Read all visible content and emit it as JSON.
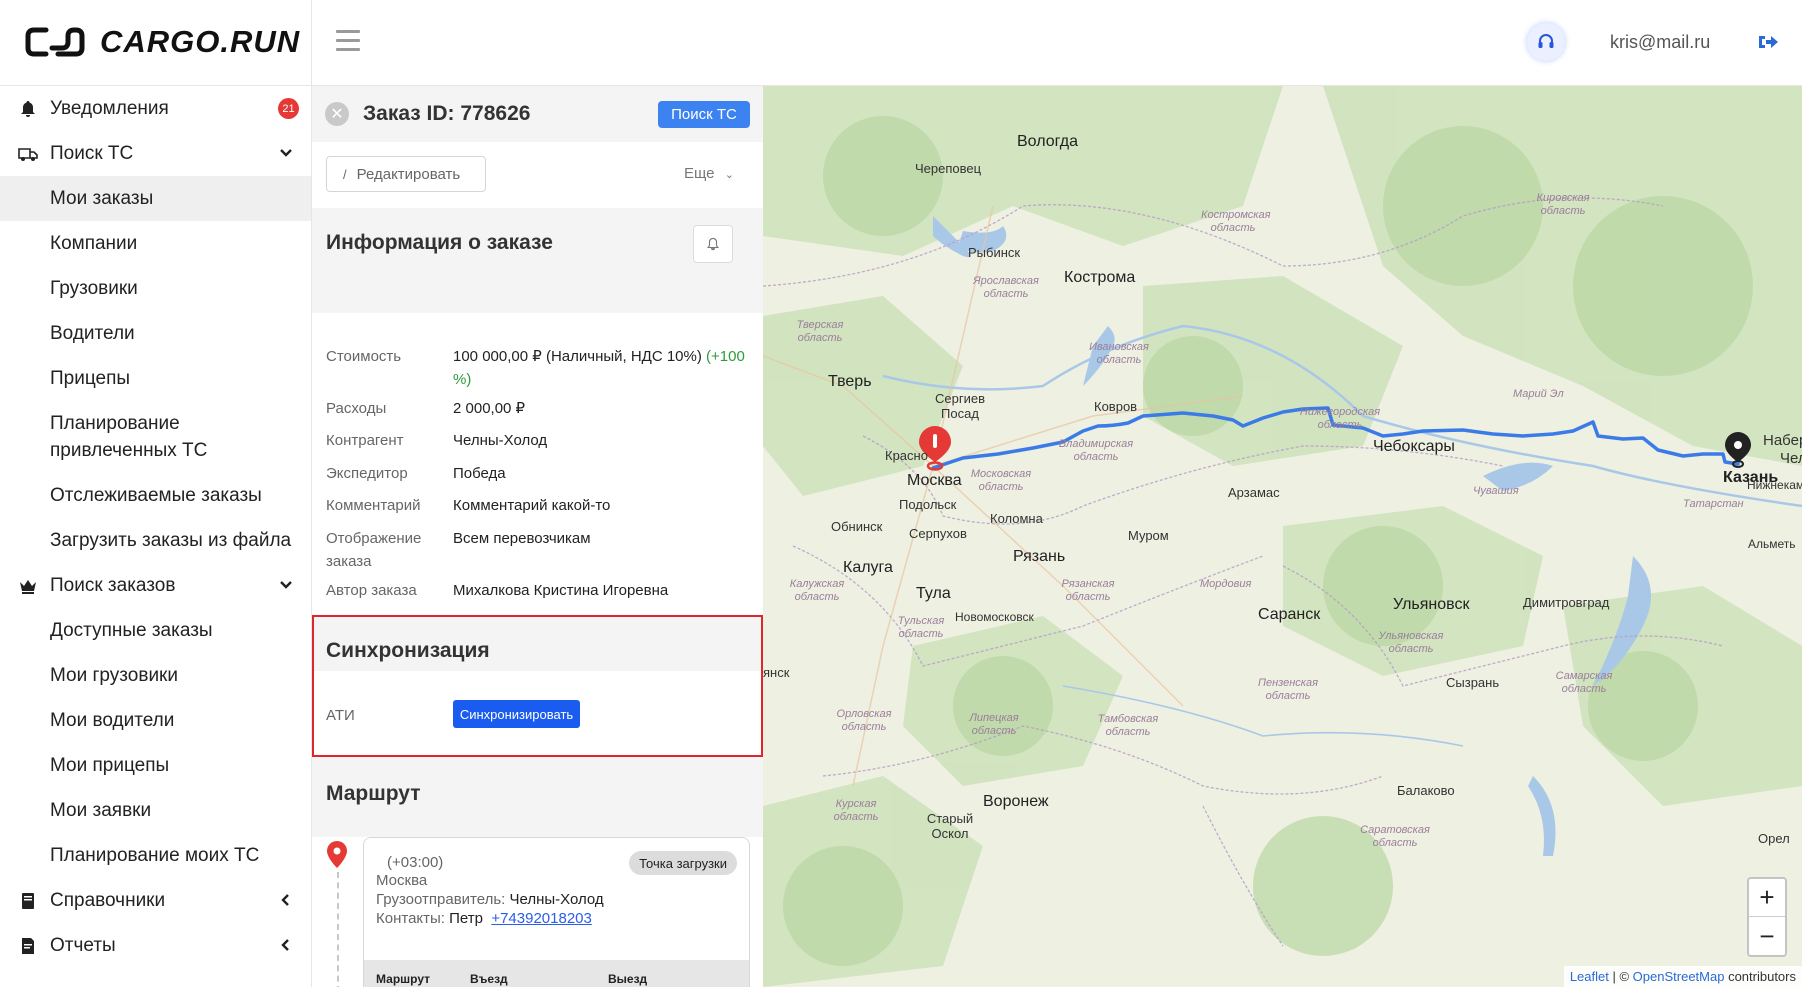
{
  "brand": {
    "name": "CARGO.RUN"
  },
  "header": {
    "user_email": "kris@mail.ru"
  },
  "sidebar": {
    "items": [
      {
        "label": "Уведомления",
        "badge": "21"
      },
      {
        "label": "Поиск ТС"
      },
      {
        "label": "Мои заказы"
      },
      {
        "label": "Компании"
      },
      {
        "label": "Грузовики"
      },
      {
        "label": "Водители"
      },
      {
        "label": "Прицепы"
      },
      {
        "label": "Планирование привлеченных ТС"
      },
      {
        "label": "Отслеживаемые заказы"
      },
      {
        "label": "Загрузить заказы из файла"
      },
      {
        "label": "Поиск заказов"
      },
      {
        "label": "Доступные заказы"
      },
      {
        "label": "Мои грузовики"
      },
      {
        "label": "Мои водители"
      },
      {
        "label": "Мои прицепы"
      },
      {
        "label": "Мои заявки"
      },
      {
        "label": "Планирование моих ТС"
      },
      {
        "label": "Справочники"
      },
      {
        "label": "Отчеты"
      }
    ]
  },
  "order": {
    "title": "Заказ ID: 778626",
    "search_ts_label": "Поиск ТС",
    "edit_label": "Редактировать",
    "more_label": "Еще"
  },
  "info": {
    "title": "Информация о заказе",
    "rows": [
      {
        "label": "Стоимость",
        "value": "100 000,00 ₽ (Наличный, НДС 10%)",
        "extra": "(+100 %)"
      },
      {
        "label": "Расходы",
        "value": "2 000,00 ₽"
      },
      {
        "label": "Контрагент",
        "value": "Челны-Холод"
      },
      {
        "label": "Экспедитор",
        "value": "Победа"
      },
      {
        "label": "Комментарий",
        "value": "Комментарий какой-то"
      },
      {
        "label": "Отображение заказа",
        "value": "Всем перевозчикам"
      },
      {
        "label": "Автор заказа",
        "value": "Михалкова Кристина Игоревна"
      }
    ]
  },
  "sync": {
    "title": "Синхронизация",
    "ati_label": "АТИ",
    "button_label": "Синхронизировать"
  },
  "route": {
    "title": "Маршрут",
    "point": {
      "timezone": "(+03:00)",
      "chip": "Точка загрузки",
      "city": "Москва",
      "shipper_label": "Грузоотправитель:",
      "shipper": "Челны-Холод",
      "contacts_label": "Контакты:",
      "contact_name": "Петр",
      "phone": "+74392018203"
    },
    "table_headers": [
      "Маршрут",
      "Въезд",
      "Выезд"
    ]
  },
  "map": {
    "cities": [
      "Вологда",
      "Череповец",
      "Рыбинск",
      "Кострома",
      "Тверь",
      "Сергиев Посад",
      "Ковров",
      "Красно",
      "Москва",
      "Подольск",
      "Муром",
      "Арзамас",
      "Чебоксары",
      "Казань",
      "Набере",
      "Челн",
      "Нижнекамск",
      "Альметь",
      "Обнинск",
      "Серпухов",
      "Коломна",
      "Калуга",
      "Рязань",
      "Тула",
      "Новомосковск",
      "Саранск",
      "Ульяновск",
      "Димитровград",
      "Сызрань",
      "Воронеж",
      "Балаково",
      "Старый Оскол",
      "Орел",
      "янск"
    ],
    "regions": [
      "Кировская область",
      "Костромская область",
      "Ярославская область",
      "Тверская область",
      "Ивановская область",
      "Нижегородская область",
      "Владимирская область",
      "Московская область",
      "Марий Эл",
      "Чувашия",
      "Татарстан",
      "Калужская область",
      "Рязанская область",
      "Мордовия",
      "Тульская область",
      "Ульяновская область",
      "Пензенская область",
      "Самарская область",
      "Орловская область",
      "Липецкая область",
      "Тамбовская область",
      "Курская область",
      "Саратовская область"
    ],
    "zoom_in": "+",
    "zoom_out": "−",
    "attribution": {
      "leaflet": "Leaflet",
      "sep": " | © ",
      "osm": "OpenStreetMap",
      "suffix": " contributors"
    },
    "route_color": "#3b7be8",
    "start_marker_color": "#e53935",
    "end_marker_color": "#222222"
  }
}
